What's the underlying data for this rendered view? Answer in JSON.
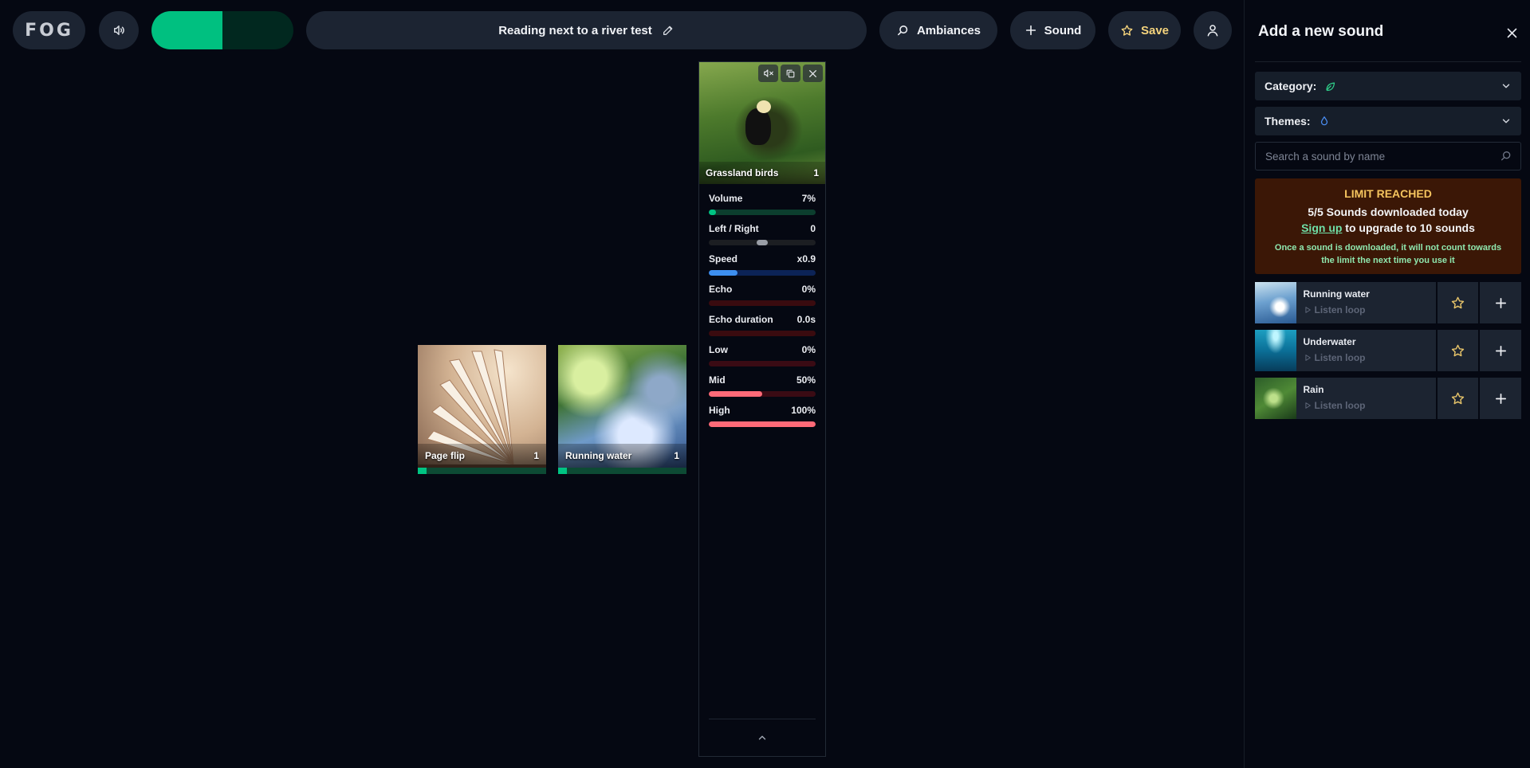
{
  "topbar": {
    "logo": "FOG",
    "master_progress": 0.5,
    "ambiance_title": "Reading next to a river test",
    "ambiances_label": "Ambiances",
    "sound_label": "Sound",
    "save_label": "Save"
  },
  "tiles": [
    {
      "name": "Page flip",
      "count": "1",
      "volume": 0.07
    },
    {
      "name": "Running water",
      "count": "1",
      "volume": 0.07
    }
  ],
  "sound_panel": {
    "name": "Grassland birds",
    "count": "1",
    "controls": [
      {
        "label": "Volume",
        "value": "7%",
        "level": 0.07,
        "track": "#0c3e2e",
        "fill": "#00c483"
      },
      {
        "label": "Left / Right",
        "value": "0",
        "level": 0.5,
        "track": "#1c1e22",
        "fill": "#9a9ea6"
      },
      {
        "label": "Speed",
        "value": "x0.9",
        "level": 0.27,
        "track": "#0c2356",
        "fill": "#3d8ff0"
      },
      {
        "label": "Echo",
        "value": "0%",
        "level": 0.0,
        "track": "#3a0b0f",
        "fill": "#ff6a78"
      },
      {
        "label": "Echo duration",
        "value": "0.0s",
        "level": 0.0,
        "track": "#3a0b0f",
        "fill": "#ff6a78"
      },
      {
        "label": "Low",
        "value": "0%",
        "level": 0.0,
        "track": "#3a0b14",
        "fill": "#ff6a78"
      },
      {
        "label": "Mid",
        "value": "50%",
        "level": 0.5,
        "track": "#3a0b14",
        "fill": "#ff6a78"
      },
      {
        "label": "High",
        "value": "100%",
        "level": 1.0,
        "track": "#3a0b14",
        "fill": "#ff6a78"
      }
    ]
  },
  "drawer": {
    "title": "Add a new sound",
    "category_label": "Category:",
    "themes_label": "Themes:",
    "search_placeholder": "Search a sound by name",
    "limit": {
      "heading": "LIMIT REACHED",
      "count_line": "5/5 Sounds downloaded today",
      "signup_link": "Sign up",
      "upgrade_text": " to upgrade to 10 sounds",
      "note": "Once a sound is downloaded, it will not count towards the limit the next time you use it"
    },
    "listen_label": "Listen loop",
    "results": [
      {
        "name": "Running water"
      },
      {
        "name": "Underwater"
      },
      {
        "name": "Rain"
      }
    ]
  },
  "colors": {
    "accent_green": "#00c080",
    "save_yellow": "#f4d37c",
    "limit_bg": "#3b1706",
    "limit_heading": "#f5c45e"
  },
  "icons": [
    "speaker-icon",
    "pencil-icon",
    "search-icon",
    "plus-icon",
    "star-icon",
    "user-icon",
    "mute-icon",
    "copy-icon",
    "close-icon",
    "leaf-icon",
    "drop-icon",
    "chevron-down-icon",
    "chevron-up-icon",
    "play-icon"
  ]
}
